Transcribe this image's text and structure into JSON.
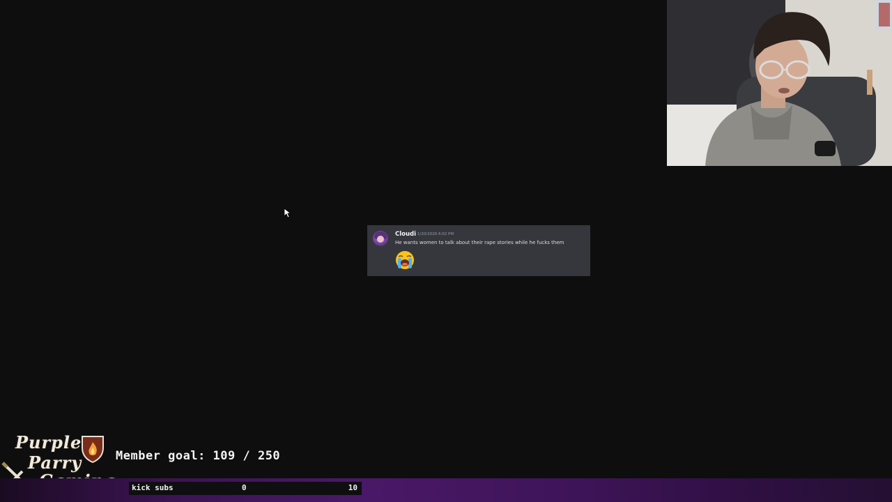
{
  "message": {
    "author": "Cloudi",
    "timestamp": "1/20/2026 6:02 PM",
    "text": "He wants women to talk about their rape stories while he fucks them",
    "emoji": "loudly-crying-face"
  },
  "overlay": {
    "logo_line1": "Purple",
    "logo_line2": "Parry",
    "logo_line3": "Gaming",
    "member_goal": "Member goal: 109 / 250",
    "sub_label": "kick subs",
    "sub_current": "0",
    "sub_target": "10",
    "accent_color": "#4a1868"
  },
  "webcam": {
    "icon": "streamer-webcam-feed"
  }
}
